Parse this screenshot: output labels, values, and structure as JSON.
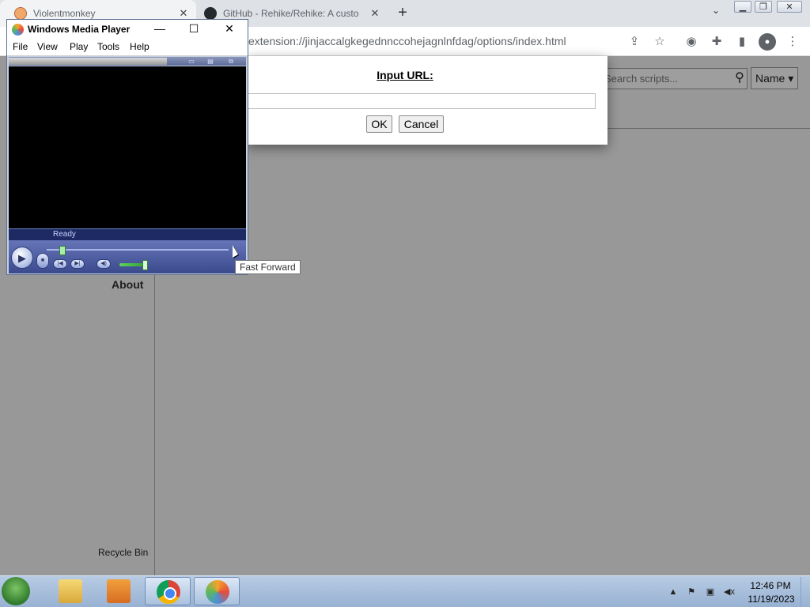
{
  "browser": {
    "tabs": [
      {
        "title": "Violentmonkey",
        "icon": "violentmonkey-icon"
      },
      {
        "title": "GitHub - Rehike/Rehike: A custo",
        "icon": "github-icon"
      }
    ],
    "new_tab_label": "+",
    "tab_menu_label": "⌄",
    "url": "extension://jinjaccalgkegednnccohejagnlnfdag/options/index.html",
    "window_controls": {
      "minimize": "▁",
      "restore": "❐",
      "close": "✕"
    }
  },
  "page": {
    "search_placeholder": "Search scripts...",
    "sort_value": "Name",
    "about_label": "About",
    "recycle_bin_label": "Recycle Bin"
  },
  "dialog": {
    "title": "Input URL:",
    "input_value": "",
    "ok_label": "OK",
    "cancel_label": "Cancel"
  },
  "wmp": {
    "title": "Windows Media Player",
    "menu": [
      "File",
      "View",
      "Play",
      "Tools",
      "Help"
    ],
    "status": "Ready",
    "tooltip": "Fast Forward",
    "seek_position": 0.07,
    "volume_level": 0.8
  },
  "taskbar": {
    "apps": [
      "Windows Explorer",
      "Windows Media Center",
      "Google Chrome",
      "Windows Media Player"
    ],
    "clock_time": "12:46 PM",
    "clock_date": "11/19/2023"
  },
  "colors": {
    "dialog_bg": "#ffffff",
    "overlay": "rgba(0,0,0,0.38)",
    "wmp_chrome": "#3a4a8c",
    "taskbar": "#98b2d3"
  }
}
